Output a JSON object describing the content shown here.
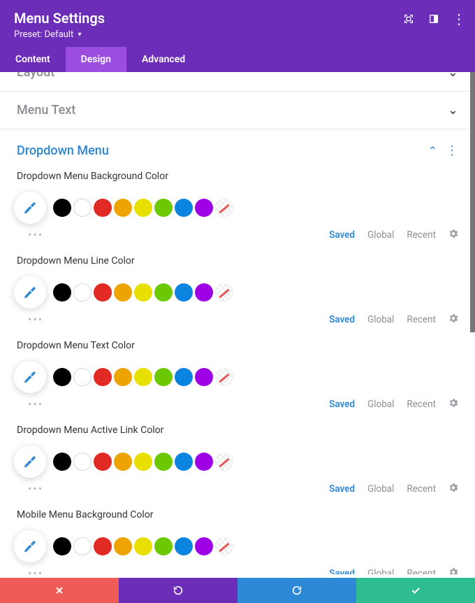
{
  "header": {
    "title": "Menu Settings",
    "preset_prefix": "Preset:",
    "preset_value": "Default"
  },
  "tabs": {
    "content": "Content",
    "design": "Design",
    "advanced": "Advanced"
  },
  "sections": {
    "layout": "Layout",
    "menu_text": "Menu Text",
    "dropdown_menu": "Dropdown Menu"
  },
  "options": [
    {
      "label": "Dropdown Menu Background Color"
    },
    {
      "label": "Dropdown Menu Line Color"
    },
    {
      "label": "Dropdown Menu Text Color"
    },
    {
      "label": "Dropdown Menu Active Link Color"
    },
    {
      "label": "Mobile Menu Background Color"
    }
  ],
  "swatches": [
    "black",
    "white",
    "red",
    "orange",
    "yellow",
    "green",
    "blue",
    "purple",
    "transparent"
  ],
  "foot": {
    "saved": "Saved",
    "global": "Global",
    "recent": "Recent"
  }
}
